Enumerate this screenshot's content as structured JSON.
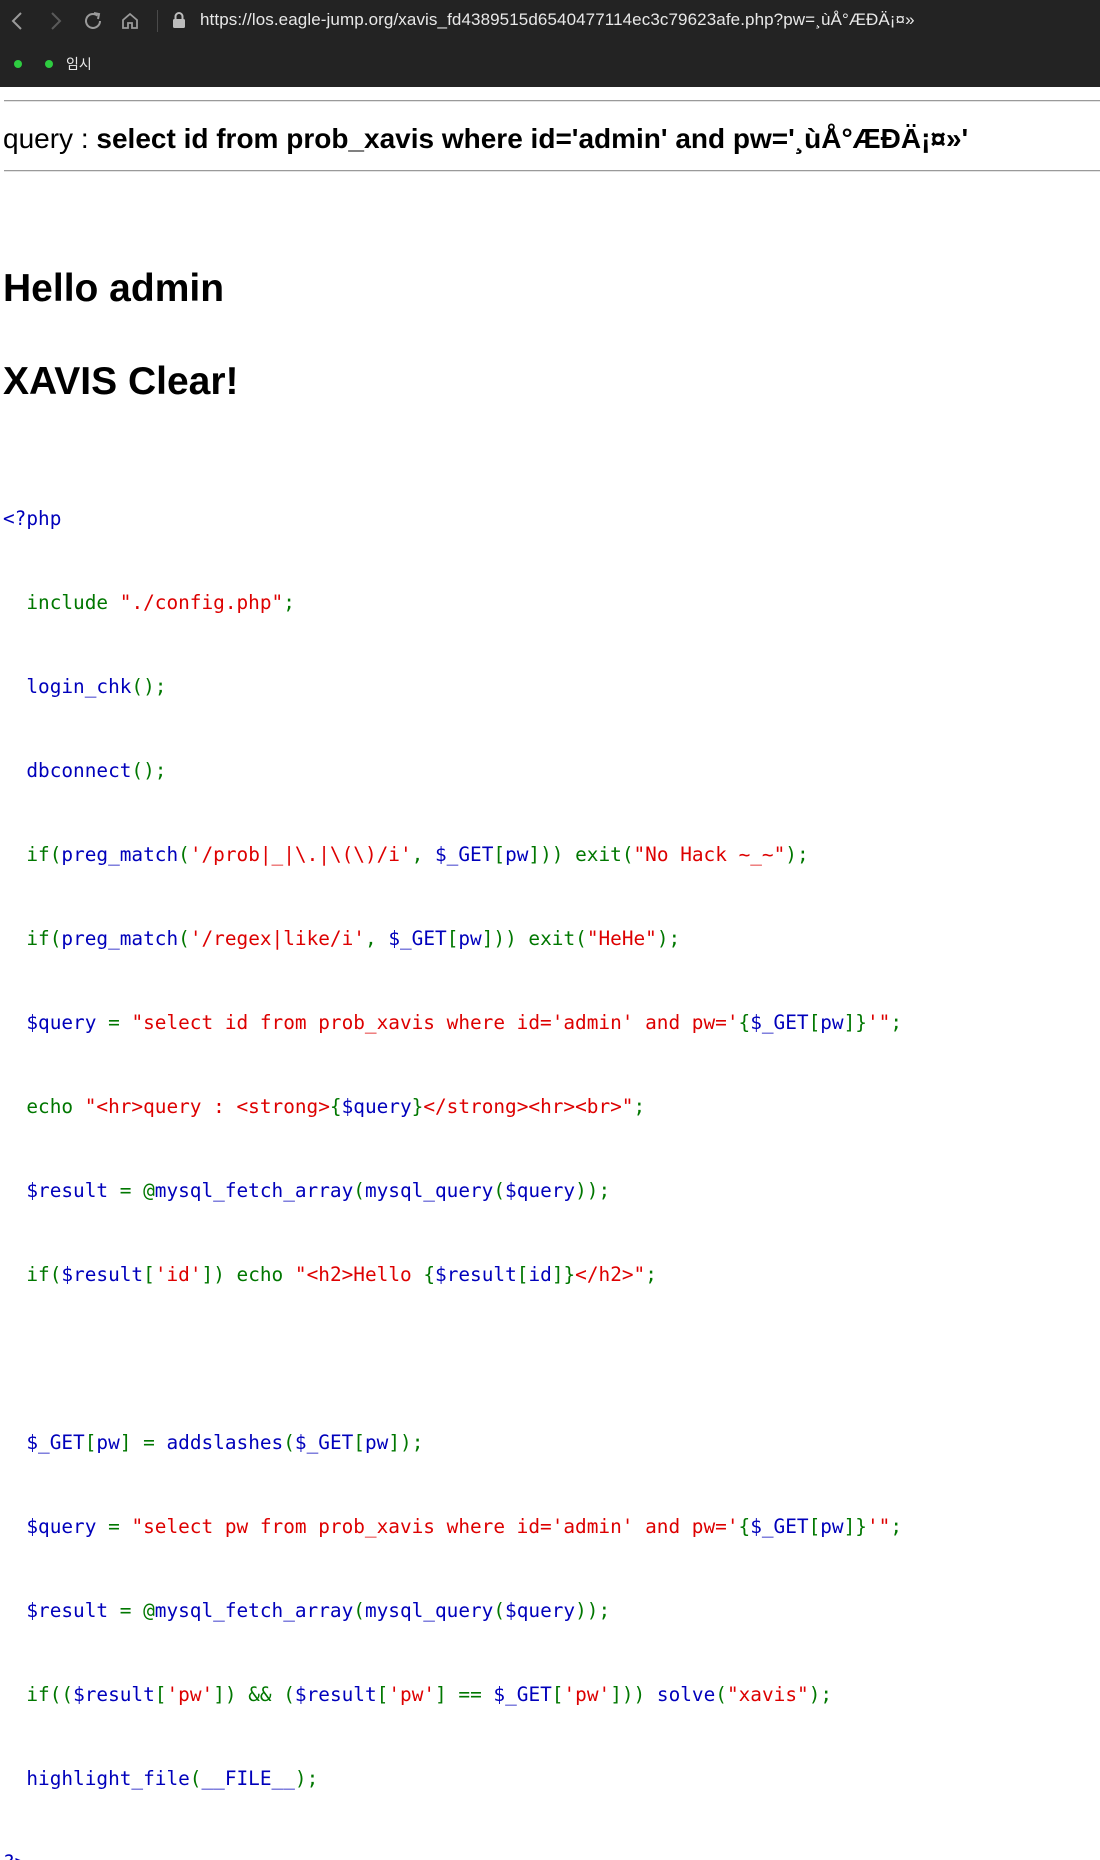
{
  "browser": {
    "url": "https://los.eagle-jump.org/xavis_fd4389515d6540477114ec3c79623afe.php?pw=¸ùÅ°ÆÐÄ¡¤»",
    "bookmark_label": "임시",
    "accent_dot_color": "#2ecc40"
  },
  "page": {
    "query_prefix": "query : ",
    "query_text": "select id from prob_xavis where id='admin' and pw='¸ùÅ°ÆÐÄ¡¤»'",
    "hello_text": "Hello admin",
    "clear_text": "XAVIS Clear!"
  },
  "code": {
    "l01": {
      "a": "<?php"
    },
    "l02": {
      "a": "  ",
      "b": "include ",
      "c": "\"./config.php\"",
      "d": ";"
    },
    "l03": {
      "a": "  login_chk",
      "b": "();"
    },
    "l04": {
      "a": "  dbconnect",
      "b": "();"
    },
    "l05": {
      "a": "  ",
      "b": "if(",
      "c": "preg_match",
      "d": "(",
      "e": "'/prob|_|\\.|\\(\\)/i'",
      "f": ", ",
      "g": "$_GET",
      "h": "[",
      "i": "pw",
      "j": "])) exit(",
      "k": "\"No Hack ~_~\"",
      "l": ");"
    },
    "l06": {
      "a": "  ",
      "b": "if(",
      "c": "preg_match",
      "d": "(",
      "e": "'/regex|like/i'",
      "f": ", ",
      "g": "$_GET",
      "h": "[",
      "i": "pw",
      "j": "])) exit(",
      "k": "\"HeHe\"",
      "l": ");"
    },
    "l07": {
      "a": "  $query ",
      "b": "= ",
      "c": "\"select id from prob_xavis where id='admin' and pw='",
      "d": "{",
      "e": "$_GET",
      "f": "[",
      "g": "pw",
      "h": "]}",
      "i": "'\"",
      "j": ";"
    },
    "l08": {
      "a": "  ",
      "b": "echo ",
      "c": "\"<hr>query : <strong>",
      "d": "{",
      "e": "$query",
      "f": "}",
      "g": "</strong><hr><br>\"",
      "h": ";"
    },
    "l09": {
      "a": "  $result ",
      "b": "= @",
      "c": "mysql_fetch_array",
      "d": "(",
      "e": "mysql_query",
      "f": "(",
      "g": "$query",
      "h": "));"
    },
    "l10": {
      "a": "  ",
      "b": "if(",
      "c": "$result",
      "d": "[",
      "e": "'id'",
      "f": "]) echo ",
      "g": "\"<h2>Hello ",
      "h": "{",
      "i": "$result",
      "j": "[",
      "k": "id",
      "l": "]}",
      "m": "</h2>\"",
      "n": ";"
    },
    "l11": {
      "a": " "
    },
    "l12": {
      "a": "  $_GET",
      "b": "[",
      "c": "pw",
      "d": "] = ",
      "e": "addslashes",
      "f": "(",
      "g": "$_GET",
      "h": "[",
      "i": "pw",
      "j": "]);"
    },
    "l13": {
      "a": "  $query ",
      "b": "= ",
      "c": "\"select pw from prob_xavis where id='admin' and pw='",
      "d": "{",
      "e": "$_GET",
      "f": "[",
      "g": "pw",
      "h": "]}",
      "i": "'\"",
      "j": ";"
    },
    "l14": {
      "a": "  $result ",
      "b": "= @",
      "c": "mysql_fetch_array",
      "d": "(",
      "e": "mysql_query",
      "f": "(",
      "g": "$query",
      "h": "));"
    },
    "l15": {
      "a": "  ",
      "b": "if((",
      "c": "$result",
      "d": "[",
      "e": "'pw'",
      "f": "]) && (",
      "g": "$result",
      "h": "[",
      "i": "'pw'",
      "j": "] == ",
      "k": "$_GET",
      "l": "[",
      "m": "'pw'",
      "n": "])) ",
      "o": "solve",
      "p": "(",
      "q": "\"xavis\"",
      "r": ");"
    },
    "l16": {
      "a": "  highlight_file",
      "b": "(",
      "c": "__FILE__",
      "d": ");"
    },
    "l17": {
      "a": "?>"
    }
  }
}
